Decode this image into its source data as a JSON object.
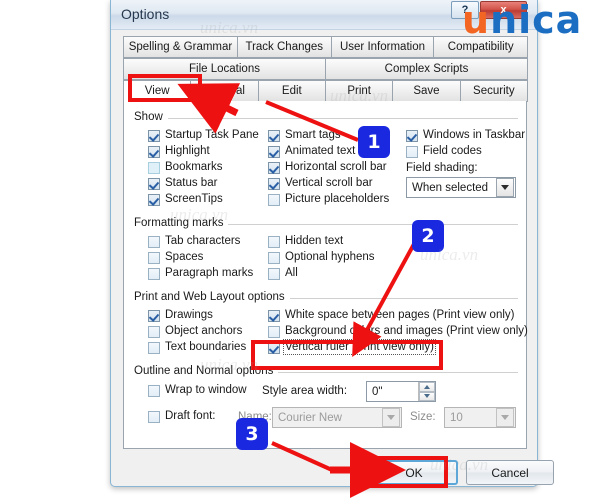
{
  "window": {
    "title": "Options",
    "help_button": "?",
    "close_button": "x"
  },
  "watermark": {
    "logo_first": "u",
    "logo_rest": "nica",
    "texts": [
      "unica.vn",
      "unica.vn",
      "unica.vn",
      "unica.vn",
      "unica.vn",
      "unica.vn"
    ]
  },
  "tabs": {
    "row1": [
      {
        "label": "Spelling & Grammar",
        "active": false
      },
      {
        "label": "Track Changes",
        "active": false
      },
      {
        "label": "User Information",
        "active": false
      },
      {
        "label": "Compatibility",
        "active": false
      }
    ],
    "row2": [
      {
        "label": "File Locations",
        "active": false
      },
      {
        "label": "Complex Scripts",
        "active": false
      }
    ],
    "row3": [
      {
        "label": "View",
        "active": true
      },
      {
        "label": "General",
        "active": false
      },
      {
        "label": "Edit",
        "active": false
      },
      {
        "label": "Print",
        "active": false
      },
      {
        "label": "Save",
        "active": false
      },
      {
        "label": "Security",
        "active": false
      }
    ]
  },
  "groups": {
    "show": {
      "label": "Show",
      "col1": [
        {
          "label": "Startup Task Pane",
          "checked": true
        },
        {
          "label": "Highlight",
          "checked": true
        },
        {
          "label": "Bookmarks",
          "checked": false
        },
        {
          "label": "Status bar",
          "checked": true
        },
        {
          "label": "ScreenTips",
          "checked": true
        }
      ],
      "col2": [
        {
          "label": "Smart tags",
          "checked": true
        },
        {
          "label": "Animated text",
          "checked": true
        },
        {
          "label": "Horizontal scroll bar",
          "checked": true
        },
        {
          "label": "Vertical scroll bar",
          "checked": true
        },
        {
          "label": "Picture placeholders",
          "checked": false
        }
      ],
      "col3": [
        {
          "label": "Windows in Taskbar",
          "checked": true
        },
        {
          "label": "Field codes",
          "checked": false
        }
      ],
      "field_shading_label": "Field shading:",
      "field_shading_value": "When selected"
    },
    "formatting_marks": {
      "label": "Formatting marks",
      "col1": [
        {
          "label": "Tab characters",
          "checked": false
        },
        {
          "label": "Spaces",
          "checked": false
        },
        {
          "label": "Paragraph marks",
          "checked": false
        }
      ],
      "col2": [
        {
          "label": "Hidden text",
          "checked": false
        },
        {
          "label": "Optional hyphens",
          "checked": false
        },
        {
          "label": "All",
          "checked": false
        }
      ]
    },
    "print_web_layout": {
      "label": "Print and Web Layout options",
      "col1": [
        {
          "label": "Drawings",
          "checked": true
        },
        {
          "label": "Object anchors",
          "checked": false
        },
        {
          "label": "Text boundaries",
          "checked": false
        }
      ],
      "col2": [
        {
          "label": "White space between pages (Print view only)",
          "checked": true
        },
        {
          "label": "Background colors and images (Print view only)",
          "checked": false
        },
        {
          "label": "Vertical ruler (Print view only)",
          "checked": true
        }
      ]
    },
    "outline_normal": {
      "label": "Outline and Normal options",
      "wrap_to_window": {
        "label": "Wrap to window",
        "checked": false
      },
      "draft_font": {
        "label": "Draft font:",
        "checked": false
      },
      "style_area_label": "Style area width:",
      "style_area_value": "0\"",
      "name_label": "Name:",
      "font_name_value": "Courier New",
      "size_label": "Size:",
      "size_value": "10"
    }
  },
  "footer": {
    "ok": "OK",
    "cancel": "Cancel"
  },
  "annotations": {
    "badges": [
      {
        "text": "1"
      },
      {
        "text": "2"
      },
      {
        "text": "3"
      }
    ],
    "accent_color": "#ee1111",
    "badge_color": "#1a28e0"
  }
}
